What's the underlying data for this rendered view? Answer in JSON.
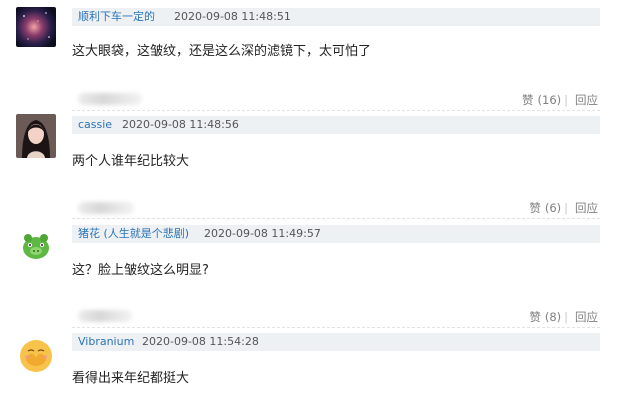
{
  "comments": [
    {
      "user": "顺利下车一定的",
      "time": "2020-09-08 11:48:51",
      "text": "这大眼袋，这皱纹，还是这么深的滤镜下，太可怕了",
      "like_label": "赞",
      "like_count": "(16)",
      "reply_label": "回应"
    },
    {
      "user": "cassie",
      "time": "2020-09-08 11:48:56",
      "text": "两个人谁年纪比较大",
      "like_label": "赞",
      "like_count": "(6)",
      "reply_label": "回应"
    },
    {
      "user": "猪花 (人生就是个悲剧)",
      "time": "2020-09-08 11:49:57",
      "text": "这？脸上皱纹这么明显?",
      "like_label": "赞",
      "like_count": "(8)",
      "reply_label": "回应"
    },
    {
      "user": "Vibranium",
      "time": "2020-09-08 11:54:28",
      "text": "看得出来年纪都挺大"
    }
  ]
}
